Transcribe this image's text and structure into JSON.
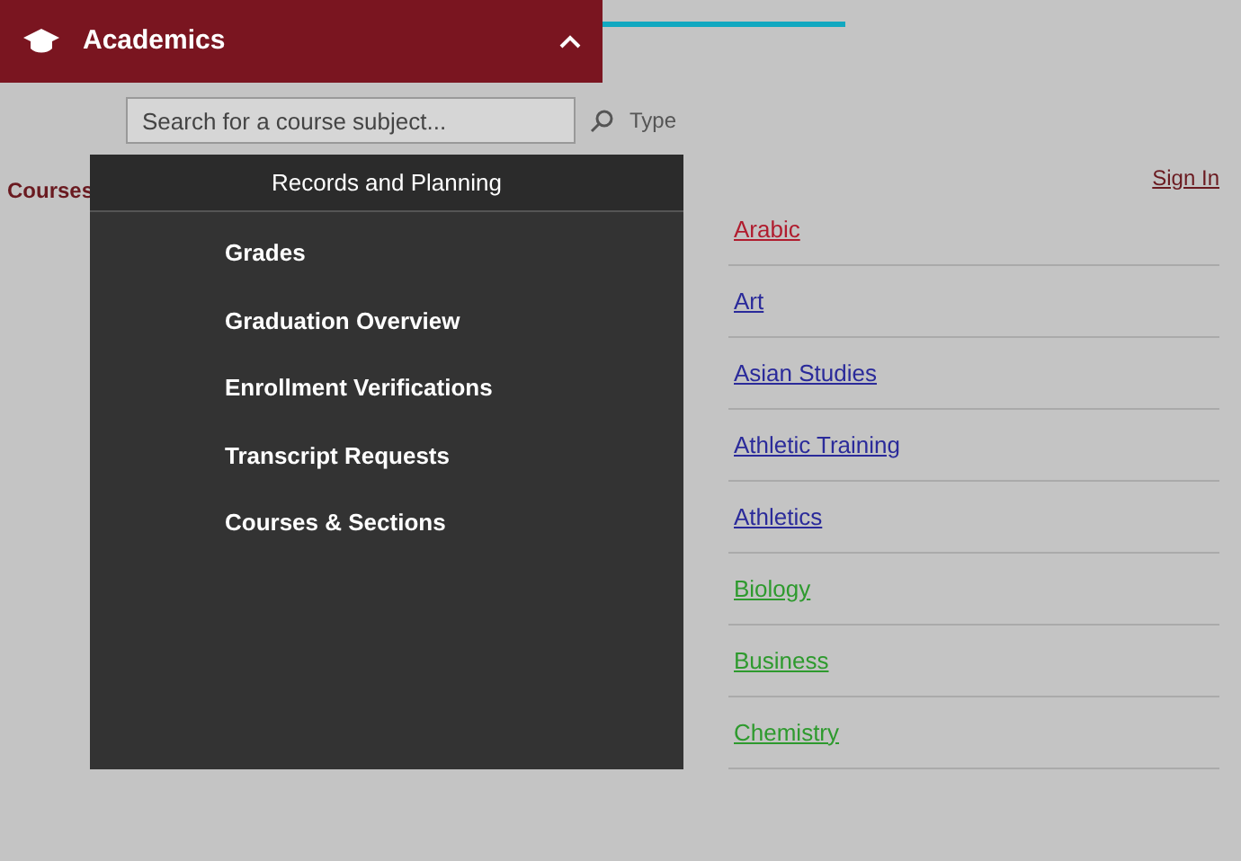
{
  "header": {
    "title": "Academics",
    "expanded": true
  },
  "search": {
    "placeholder": "Search for a course subject...",
    "type_label": "Type"
  },
  "section_title": "Records and Planning",
  "sidebar_label": "Courses",
  "menu": [
    {
      "label": "Grades"
    },
    {
      "label": "Graduation Overview"
    },
    {
      "label": "Enrollment Verifications"
    },
    {
      "label": "Transcript Requests"
    },
    {
      "label": "Courses & Sections"
    }
  ],
  "sign_in": "Sign In",
  "subjects": [
    {
      "label": "Arabic",
      "color": "#b01c2e"
    },
    {
      "label": "Art",
      "color": "#2a2a9a"
    },
    {
      "label": "Asian Studies",
      "color": "#2a2a9a"
    },
    {
      "label": "Athletic Training",
      "color": "#2a2a9a"
    },
    {
      "label": "Athletics",
      "color": "#2a2a9a"
    },
    {
      "label": "Biology",
      "color": "#2e9a2e"
    },
    {
      "label": "Business",
      "color": "#2e9a2e"
    },
    {
      "label": "Chemistry",
      "color": "#2e9a2e"
    }
  ]
}
